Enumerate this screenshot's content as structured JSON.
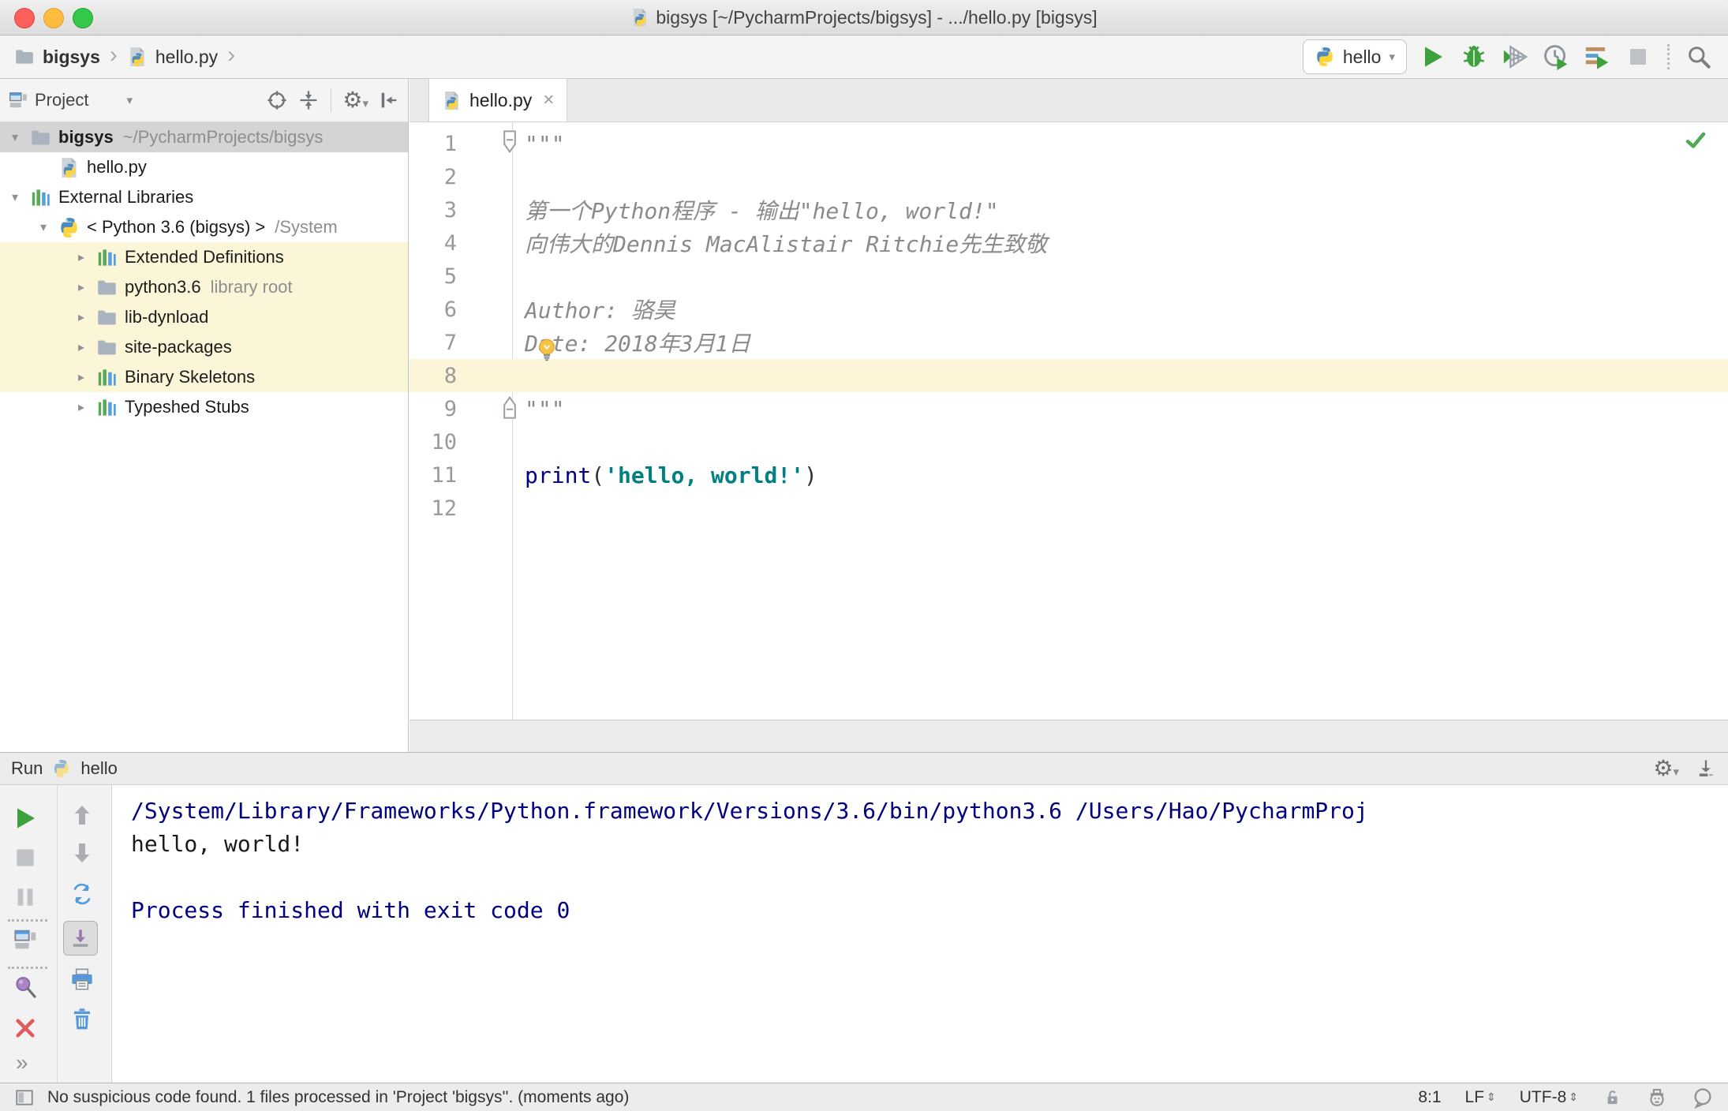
{
  "window": {
    "title": "bigsys [~/PycharmProjects/bigsys] - .../hello.py [bigsys]"
  },
  "toolbar": {
    "breadcrumb": [
      {
        "label": "bigsys"
      },
      {
        "label": "hello.py"
      }
    ],
    "run_config": "hello"
  },
  "project_panel": {
    "title": "Project",
    "tree": [
      {
        "label": "bigsys",
        "annotation": "~/PycharmProjects/bigsys"
      },
      {
        "label": "hello.py",
        "annotation": ""
      },
      {
        "label": "External Libraries",
        "annotation": ""
      },
      {
        "label": "< Python 3.6 (bigsys) >",
        "annotation": "/System"
      },
      {
        "label": "Extended Definitions",
        "annotation": ""
      },
      {
        "label": "python3.6",
        "annotation": "library root"
      },
      {
        "label": "lib-dynload",
        "annotation": ""
      },
      {
        "label": "site-packages",
        "annotation": ""
      },
      {
        "label": "Binary Skeletons",
        "annotation": ""
      },
      {
        "label": "Typeshed Stubs",
        "annotation": ""
      }
    ]
  },
  "editor": {
    "tab": "hello.py",
    "lines": [
      {
        "num": "1",
        "text": "\"\"\""
      },
      {
        "num": "2",
        "text": ""
      },
      {
        "num": "3",
        "text": "第一个Python程序 - 输出\"hello, world!\""
      },
      {
        "num": "4",
        "text": "向伟大的Dennis MacAlistair Ritchie先生致敬"
      },
      {
        "num": "5",
        "text": ""
      },
      {
        "num": "6",
        "text": "Author: 骆昊"
      },
      {
        "num": "7",
        "text": "Date: 2018年3月1日"
      },
      {
        "num": "8",
        "text": ""
      },
      {
        "num": "9",
        "text": "\"\"\""
      },
      {
        "num": "10",
        "text": ""
      },
      {
        "num": "11",
        "segments": {
          "kw": "print",
          "p1": "(",
          "str": "'hello, world!'",
          "p2": ")"
        }
      },
      {
        "num": "12",
        "text": ""
      }
    ]
  },
  "run_panel": {
    "label": "Run",
    "config": "hello",
    "console": [
      "/System/Library/Frameworks/Python.framework/Versions/3.6/bin/python3.6 /Users/Hao/PycharmProj",
      "hello, world!",
      "",
      "Process finished with exit code 0"
    ]
  },
  "status_bar": {
    "message": "No suspicious code found. 1 files processed in 'Project 'bigsys''. (moments ago)",
    "caret_position": "8:1",
    "line_separator": "LF",
    "encoding": "UTF-8"
  },
  "icons": {
    "chevron_down": "▾",
    "chevron_right": "▸",
    "breadcrumb_sep": "›",
    "dropdown_caret": "▾",
    "gear": "⚙",
    "close_tab": "×",
    "more": "»",
    "updown": "⇕"
  }
}
